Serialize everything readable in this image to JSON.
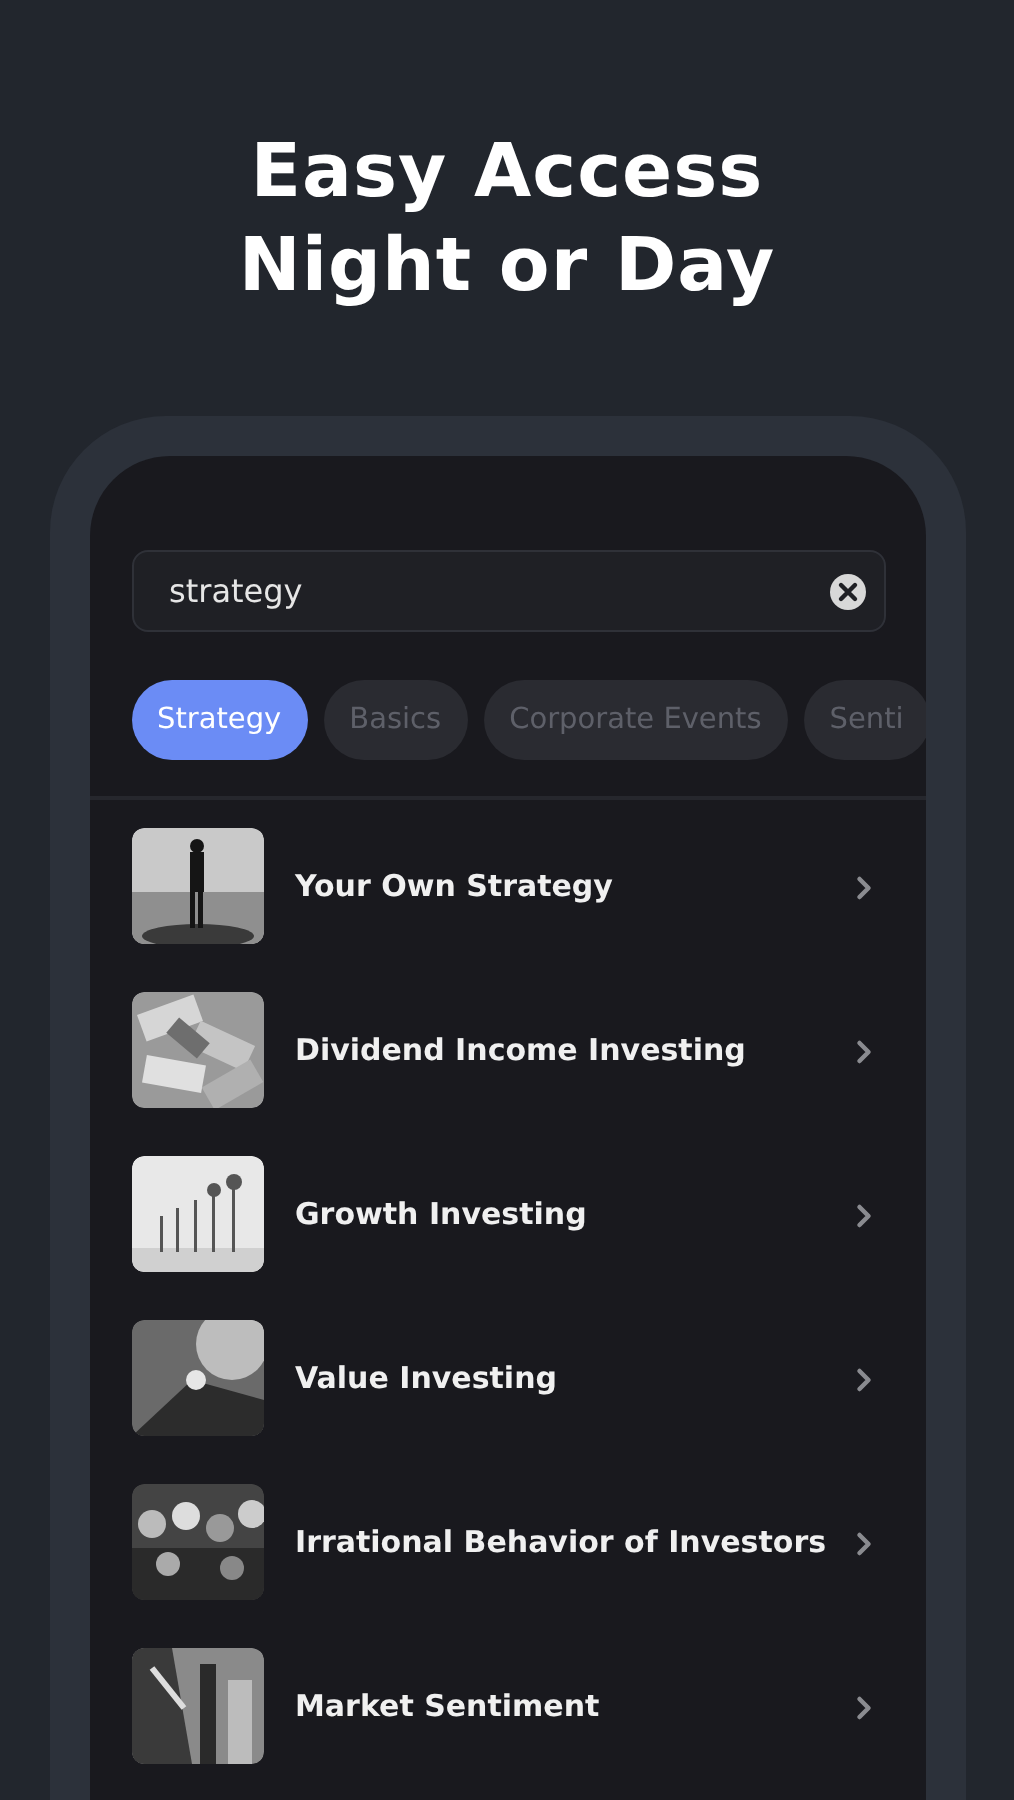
{
  "headline": [
    "Easy Access",
    "Night or Day"
  ],
  "search": {
    "value": "strategy"
  },
  "chips": [
    {
      "label": "Strategy",
      "selected": true
    },
    {
      "label": "Basics",
      "selected": false
    },
    {
      "label": "Corporate Events",
      "selected": false
    },
    {
      "label": "Senti",
      "selected": false
    }
  ],
  "items": [
    {
      "title": "Your Own Strategy"
    },
    {
      "title": "Dividend Income Investing"
    },
    {
      "title": "Growth Investing"
    },
    {
      "title": "Value Investing"
    },
    {
      "title": "Irrational Behavior of Investors"
    },
    {
      "title": "Market Sentiment"
    }
  ]
}
